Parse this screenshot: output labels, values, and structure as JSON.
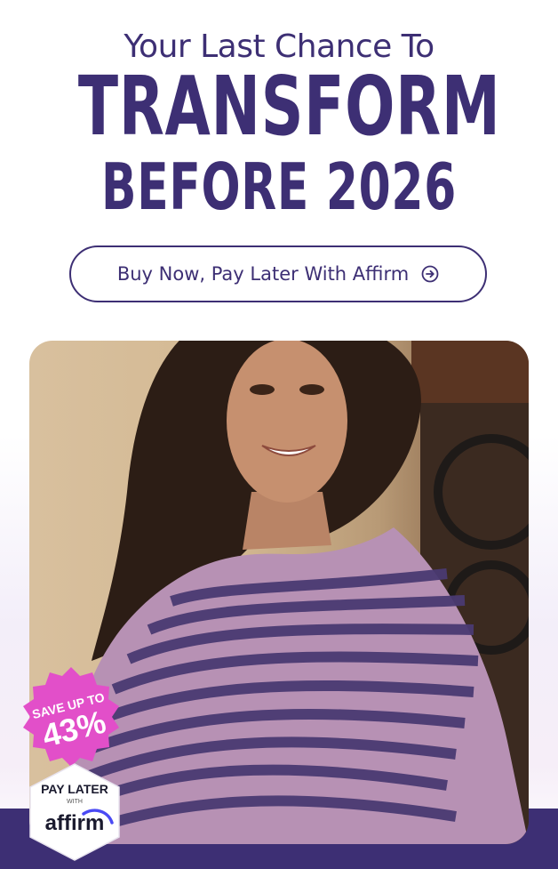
{
  "header": {
    "line1": "Your Last Chance To",
    "line2": "TRANSFORM",
    "line3": "BEFORE 2026"
  },
  "cta": {
    "label": "Buy Now, Pay Later With Affirm",
    "icon": "arrow-right-circle-icon"
  },
  "badges": {
    "save": {
      "line1": "SAVE UP TO",
      "value": "43%",
      "color": "#e24fc9"
    },
    "affirm": {
      "top": "PAY LATER",
      "middle": "WITH",
      "brand": "affirm"
    }
  },
  "colors": {
    "brand": "#3d2f74",
    "accent": "#e24fc9",
    "affirm_blue": "#4a4af4"
  }
}
